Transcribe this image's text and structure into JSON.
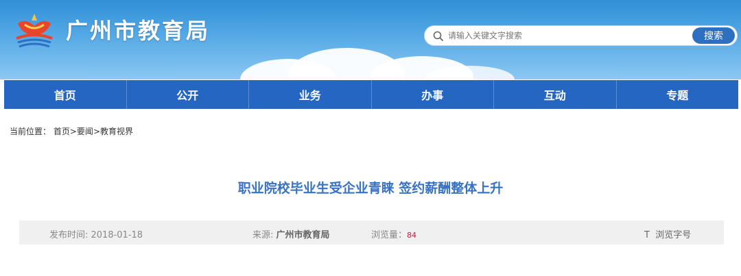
{
  "header": {
    "site_title": "广州市教育局",
    "logo": "guangzhou-education-logo"
  },
  "search": {
    "placeholder": "请输入关键文字搜索",
    "button_label": "搜索",
    "icon": "search-icon"
  },
  "nav": {
    "items": [
      {
        "label": "首页"
      },
      {
        "label": "公开"
      },
      {
        "label": "业务"
      },
      {
        "label": "办事"
      },
      {
        "label": "互动"
      },
      {
        "label": "专题"
      }
    ]
  },
  "breadcrumb": {
    "prefix": "当前位置：",
    "items": [
      {
        "label": "首页"
      },
      {
        "label": "要闻"
      },
      {
        "label": "教育视界"
      }
    ],
    "separator": ">"
  },
  "article": {
    "title": "职业院校毕业生受企业青睐 签约薪酬整体上升",
    "meta": {
      "date": "发布时间: 2018-01-18",
      "source_label": "来源: ",
      "source_value": "广州市教育局",
      "views_label": "浏览量：",
      "views_count": "84",
      "font_icon": "T",
      "font_label": "浏览字号"
    }
  },
  "colors": {
    "nav_bg": "#2466c2",
    "title_color": "#3872c5",
    "search_button": "#2d6fc1",
    "views_count": "#b0264a"
  }
}
